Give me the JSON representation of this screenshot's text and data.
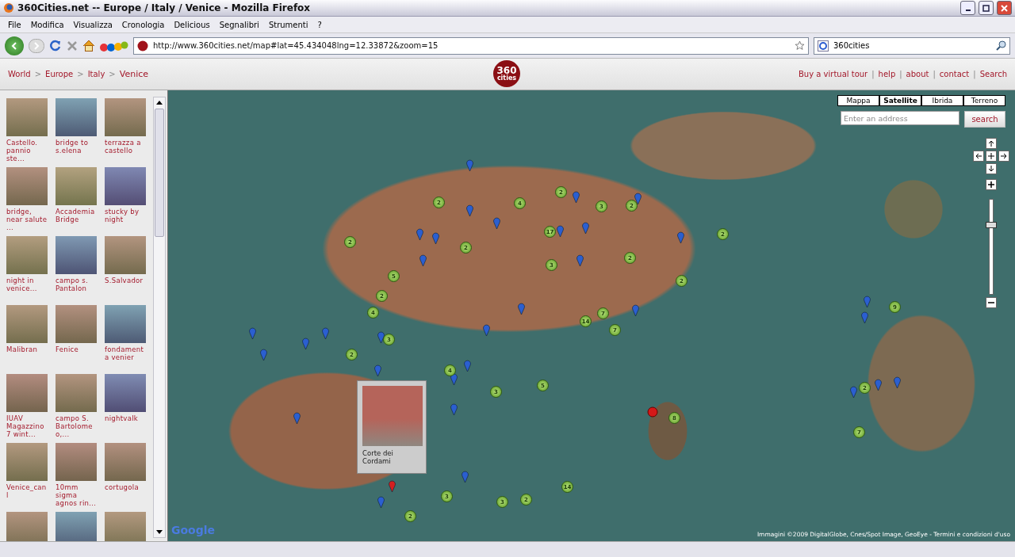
{
  "window": {
    "title": "360Cities.net -- Europe / Italy / Venice - Mozilla Firefox"
  },
  "menu": [
    "File",
    "Modifica",
    "Visualizza",
    "Cronologia",
    "Delicious",
    "Segnalibri",
    "Strumenti",
    "?"
  ],
  "toolbar": {
    "url": "http://www.360cities.net/map#lat=45.434048lng=12.33872&zoom=15",
    "search_value": "360cities"
  },
  "site_header": {
    "breadcrumb_separator": ">",
    "link_separator": "|",
    "breadcrumbs": [
      "World",
      "Europe",
      "Italy",
      "Venice"
    ],
    "logo": "360",
    "logo_sub": "cities",
    "links": [
      "Buy a virtual tour",
      "help",
      "about",
      "contact",
      "Search"
    ]
  },
  "sidebar": {
    "items": [
      {
        "kind": "captioned",
        "caption": "Castello. pannio ste..."
      },
      {
        "kind": "captioned",
        "caption": "bridge to s.elena"
      },
      {
        "kind": "captioned",
        "caption": "terrazza a castello"
      },
      {
        "kind": "captioned",
        "caption": "bridge, near salute ..."
      },
      {
        "kind": "captioned",
        "caption": "Accademia Bridge"
      },
      {
        "kind": "captioned",
        "caption": "stucky by night"
      },
      {
        "kind": "captioned",
        "caption": "night in venice..."
      },
      {
        "kind": "captioned",
        "caption": "campo s. Pantalon"
      },
      {
        "kind": "captioned",
        "caption": "S.Salvador"
      },
      {
        "kind": "captioned",
        "caption": "Malibran"
      },
      {
        "kind": "captioned",
        "caption": "Fenice"
      },
      {
        "kind": "captioned",
        "caption": "fondamenta venier"
      },
      {
        "kind": "captioned",
        "caption": "IUAV Magazzino7 wint..."
      },
      {
        "kind": "captioned",
        "caption": "campo S. Bartolomeo,..."
      },
      {
        "kind": "captioned",
        "caption": "nightvalk"
      },
      {
        "kind": "captioned",
        "caption": "Venice_can l"
      },
      {
        "kind": "captioned",
        "caption": "10mm sigma agnos rin..."
      },
      {
        "kind": "captioned",
        "caption": "cortugola"
      },
      {
        "kind": "thumbnail"
      },
      {
        "kind": "thumbnail"
      },
      {
        "kind": "thumbnail"
      }
    ]
  },
  "map": {
    "types": [
      {
        "label": "Mappa",
        "selected": false
      },
      {
        "label": "Satellite",
        "selected": true
      },
      {
        "label": "Ibrida",
        "selected": false
      },
      {
        "label": "Terreno",
        "selected": false
      }
    ],
    "address_placeholder": "Enter an address",
    "zoom_slider": {
      "level": 0.75
    },
    "search_button": "search",
    "clusters": [
      "2",
      "4",
      "2",
      "3",
      "2",
      "2",
      "2",
      "2",
      "17",
      "2",
      "3",
      "5",
      "2",
      "2",
      "4",
      "7",
      "14",
      "7",
      "9",
      "3",
      "2",
      "4",
      "5",
      "3",
      "8",
      "2",
      "7",
      "14",
      "3",
      "3",
      "2",
      "2"
    ],
    "popup": {
      "caption": "Corte dei Cordami"
    },
    "google_logo": "Google",
    "attribution": "Immagini ©2009 DigitalGlobe, Cnes/Spot Image, GeoEye - Termini e condizioni d'uso"
  }
}
